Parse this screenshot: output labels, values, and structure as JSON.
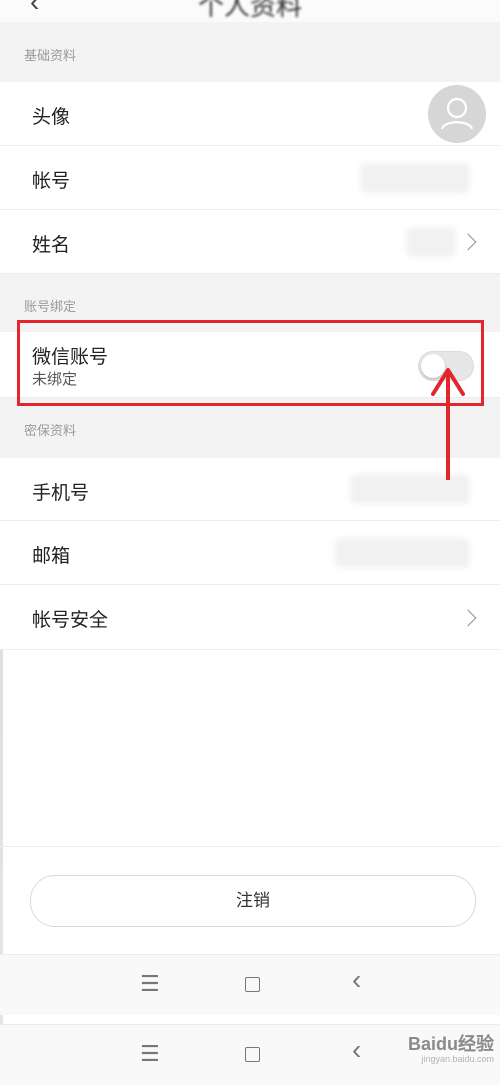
{
  "header": {
    "back_icon": "chevron-left-icon",
    "title": "个人资料"
  },
  "sections": {
    "basic": {
      "header": "基础资料"
    },
    "binding": {
      "header": "账号绑定"
    },
    "security": {
      "header": "密保资料"
    }
  },
  "rows": {
    "avatar": {
      "label": "头像"
    },
    "account": {
      "label": "帐号"
    },
    "name": {
      "label": "姓名"
    },
    "wechat": {
      "label": "微信账号",
      "status": "未绑定",
      "toggle_on": false
    },
    "phone": {
      "label": "手机号"
    },
    "email": {
      "label": "邮箱"
    },
    "account_security": {
      "label": "帐号安全"
    }
  },
  "logout_button": {
    "label": "注销"
  },
  "nav": {
    "menu_icon": "☰",
    "back_icon": "‹"
  },
  "annotation": {
    "color": "#e3262d"
  },
  "watermark": {
    "brand": "Baidu经验",
    "sub": "jingyan.baidu.com"
  }
}
